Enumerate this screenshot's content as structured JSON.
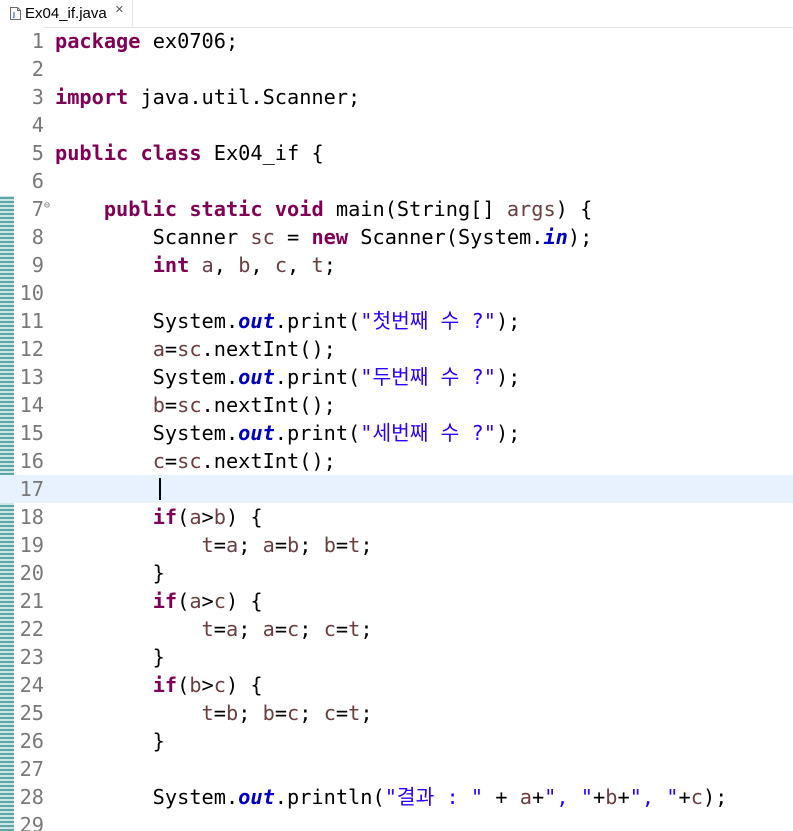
{
  "tab": {
    "title": "Ex04_if.java",
    "close_glyph": "✕"
  },
  "icons": {
    "file": "java-file-icon",
    "close": "close-icon",
    "fold": "fold-collapse-icon"
  },
  "colors": {
    "keyword": "#7f0055",
    "local_variable": "#6a3e3e",
    "string": "#2a00ff",
    "static_field": "#0000c0",
    "line_number": "#787878",
    "current_line": "#e8f2fe",
    "change_ruler": "#5fa6a7"
  },
  "editor": {
    "current_line": 17,
    "lines": [
      {
        "n": "1",
        "tokens": [
          [
            "kw",
            "package"
          ],
          [
            "",
            " ex0706;"
          ]
        ]
      },
      {
        "n": "2",
        "tokens": []
      },
      {
        "n": "3",
        "tokens": [
          [
            "kw",
            "import"
          ],
          [
            "",
            " java.util.Scanner;"
          ]
        ]
      },
      {
        "n": "4",
        "tokens": []
      },
      {
        "n": "5",
        "tokens": [
          [
            "kw",
            "public"
          ],
          [
            "",
            " "
          ],
          [
            "kw",
            "class"
          ],
          [
            "",
            " Ex04_if {"
          ]
        ]
      },
      {
        "n": "6",
        "tokens": []
      },
      {
        "n": "7",
        "fold": true,
        "tokens": [
          [
            "",
            "    "
          ],
          [
            "kw",
            "public"
          ],
          [
            "",
            " "
          ],
          [
            "kw",
            "static"
          ],
          [
            "",
            " "
          ],
          [
            "kw",
            "void"
          ],
          [
            "",
            " main(String[] "
          ],
          [
            "var",
            "args"
          ],
          [
            "",
            ") {"
          ]
        ]
      },
      {
        "n": "8",
        "tokens": [
          [
            "",
            "        Scanner "
          ],
          [
            "var",
            "sc"
          ],
          [
            "",
            " = "
          ],
          [
            "kw",
            "new"
          ],
          [
            "",
            " Scanner(System."
          ],
          [
            "fld",
            "in"
          ],
          [
            "",
            ");"
          ]
        ]
      },
      {
        "n": "9",
        "tokens": [
          [
            "",
            "        "
          ],
          [
            "kw",
            "int"
          ],
          [
            "",
            " "
          ],
          [
            "var",
            "a"
          ],
          [
            "",
            ", "
          ],
          [
            "var",
            "b"
          ],
          [
            "",
            ", "
          ],
          [
            "var",
            "c"
          ],
          [
            "",
            ", "
          ],
          [
            "var",
            "t"
          ],
          [
            "",
            ";"
          ]
        ]
      },
      {
        "n": "10",
        "tokens": []
      },
      {
        "n": "11",
        "tokens": [
          [
            "",
            "        System."
          ],
          [
            "fld",
            "out"
          ],
          [
            "",
            ".print("
          ],
          [
            "str",
            "\"첫번째 수 ?\""
          ],
          [
            "",
            ");"
          ]
        ]
      },
      {
        "n": "12",
        "tokens": [
          [
            "",
            "        "
          ],
          [
            "var",
            "a"
          ],
          [
            "",
            "="
          ],
          [
            "var",
            "sc"
          ],
          [
            "",
            ".nextInt();"
          ]
        ]
      },
      {
        "n": "13",
        "tokens": [
          [
            "",
            "        System."
          ],
          [
            "fld",
            "out"
          ],
          [
            "",
            ".print("
          ],
          [
            "str",
            "\"두번째 수 ?\""
          ],
          [
            "",
            ");"
          ]
        ]
      },
      {
        "n": "14",
        "tokens": [
          [
            "",
            "        "
          ],
          [
            "var",
            "b"
          ],
          [
            "",
            "="
          ],
          [
            "var",
            "sc"
          ],
          [
            "",
            ".nextInt();"
          ]
        ]
      },
      {
        "n": "15",
        "tokens": [
          [
            "",
            "        System."
          ],
          [
            "fld",
            "out"
          ],
          [
            "",
            ".print("
          ],
          [
            "str",
            "\"세번째 수 ?\""
          ],
          [
            "",
            ");"
          ]
        ]
      },
      {
        "n": "16",
        "tokens": [
          [
            "",
            "        "
          ],
          [
            "var",
            "c"
          ],
          [
            "",
            "="
          ],
          [
            "var",
            "sc"
          ],
          [
            "",
            ".nextInt();"
          ]
        ]
      },
      {
        "n": "17",
        "tokens": []
      },
      {
        "n": "18",
        "tokens": [
          [
            "",
            "        "
          ],
          [
            "kw",
            "if"
          ],
          [
            "",
            "("
          ],
          [
            "var",
            "a"
          ],
          [
            "",
            ">"
          ],
          [
            "var",
            "b"
          ],
          [
            "",
            ") {"
          ]
        ]
      },
      {
        "n": "19",
        "tokens": [
          [
            "",
            "            "
          ],
          [
            "var",
            "t"
          ],
          [
            "",
            "="
          ],
          [
            "var",
            "a"
          ],
          [
            "",
            "; "
          ],
          [
            "var",
            "a"
          ],
          [
            "",
            "="
          ],
          [
            "var",
            "b"
          ],
          [
            "",
            "; "
          ],
          [
            "var",
            "b"
          ],
          [
            "",
            "="
          ],
          [
            "var",
            "t"
          ],
          [
            "",
            ";"
          ]
        ]
      },
      {
        "n": "20",
        "tokens": [
          [
            "",
            "        }"
          ]
        ]
      },
      {
        "n": "21",
        "tokens": [
          [
            "",
            "        "
          ],
          [
            "kw",
            "if"
          ],
          [
            "",
            "("
          ],
          [
            "var",
            "a"
          ],
          [
            "",
            ">"
          ],
          [
            "var",
            "c"
          ],
          [
            "",
            ") {"
          ]
        ]
      },
      {
        "n": "22",
        "tokens": [
          [
            "",
            "            "
          ],
          [
            "var",
            "t"
          ],
          [
            "",
            "="
          ],
          [
            "var",
            "a"
          ],
          [
            "",
            "; "
          ],
          [
            "var",
            "a"
          ],
          [
            "",
            "="
          ],
          [
            "var",
            "c"
          ],
          [
            "",
            "; "
          ],
          [
            "var",
            "c"
          ],
          [
            "",
            "="
          ],
          [
            "var",
            "t"
          ],
          [
            "",
            ";"
          ]
        ]
      },
      {
        "n": "23",
        "tokens": [
          [
            "",
            "        }"
          ]
        ]
      },
      {
        "n": "24",
        "tokens": [
          [
            "",
            "        "
          ],
          [
            "kw",
            "if"
          ],
          [
            "",
            "("
          ],
          [
            "var",
            "b"
          ],
          [
            "",
            ">"
          ],
          [
            "var",
            "c"
          ],
          [
            "",
            ") {"
          ]
        ]
      },
      {
        "n": "25",
        "tokens": [
          [
            "",
            "            "
          ],
          [
            "var",
            "t"
          ],
          [
            "",
            "="
          ],
          [
            "var",
            "b"
          ],
          [
            "",
            "; "
          ],
          [
            "var",
            "b"
          ],
          [
            "",
            "="
          ],
          [
            "var",
            "c"
          ],
          [
            "",
            "; "
          ],
          [
            "var",
            "c"
          ],
          [
            "",
            "="
          ],
          [
            "var",
            "t"
          ],
          [
            "",
            ";"
          ]
        ]
      },
      {
        "n": "26",
        "tokens": [
          [
            "",
            "        }"
          ]
        ]
      },
      {
        "n": "27",
        "tokens": []
      },
      {
        "n": "28",
        "tokens": [
          [
            "",
            "        System."
          ],
          [
            "fld",
            "out"
          ],
          [
            "",
            ".println("
          ],
          [
            "str",
            "\"결과 : \""
          ],
          [
            "",
            " + "
          ],
          [
            "var",
            "a"
          ],
          [
            "",
            "+"
          ],
          [
            "str",
            "\", \""
          ],
          [
            "",
            "+"
          ],
          [
            "var",
            "b"
          ],
          [
            "",
            "+"
          ],
          [
            "str",
            "\", \""
          ],
          [
            "",
            "+"
          ],
          [
            "var",
            "c"
          ],
          [
            "",
            ");"
          ]
        ]
      },
      {
        "n": "29",
        "tokens": []
      }
    ]
  }
}
